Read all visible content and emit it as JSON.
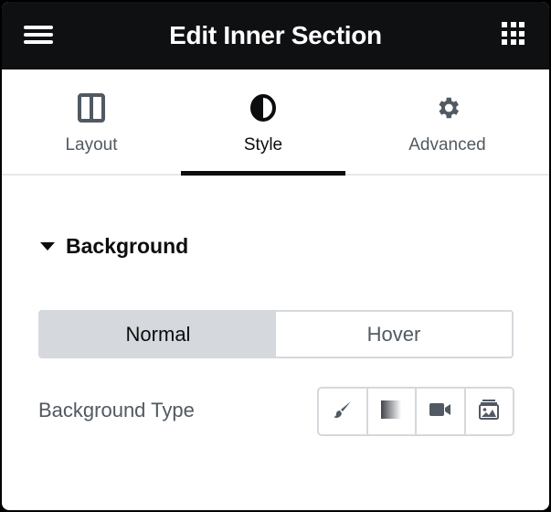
{
  "header": {
    "title": "Edit Inner Section",
    "menu_icon": "hamburger-icon",
    "apps_icon": "grid-icon"
  },
  "tabs": [
    {
      "label": "Layout",
      "icon": "columns-icon",
      "active": false
    },
    {
      "label": "Style",
      "icon": "contrast-icon",
      "active": true
    },
    {
      "label": "Advanced",
      "icon": "gear-icon",
      "active": false
    }
  ],
  "section": {
    "title": "Background",
    "expanded": true
  },
  "state_switcher": {
    "options": [
      "Normal",
      "Hover"
    ],
    "selected": "Normal"
  },
  "background_type": {
    "label": "Background Type",
    "options": [
      {
        "name": "Classic",
        "icon": "brush-icon"
      },
      {
        "name": "Gradient",
        "icon": "gradient-icon"
      },
      {
        "name": "Video",
        "icon": "video-icon"
      },
      {
        "name": "Slideshow",
        "icon": "slideshow-icon"
      }
    ]
  },
  "colors": {
    "header_bg": "#0f1012",
    "text_primary": "#0c0d0e",
    "text_secondary": "#515962",
    "border": "#d5d8dc",
    "active_segment_bg": "#d5d8dc"
  }
}
